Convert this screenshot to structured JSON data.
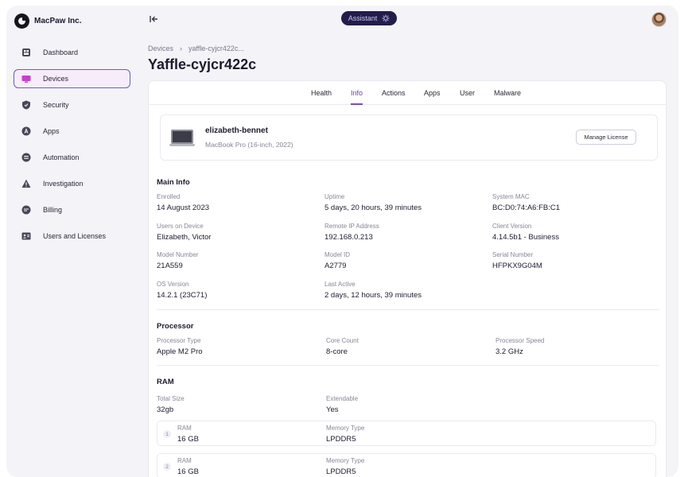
{
  "brand": {
    "name": "MacPaw Inc.",
    "icon": "macpaw-logo-icon"
  },
  "header": {
    "assistant_label": "Assistant",
    "assistant_icon": "sparkle-gear-icon",
    "collapse_icon": "collapse-sidebar-icon",
    "avatar_icon": "user-avatar"
  },
  "sidebar": {
    "items": [
      {
        "label": "Dashboard",
        "icon": "dashboard-icon"
      },
      {
        "label": "Devices",
        "icon": "monitor-icon",
        "active": true
      },
      {
        "label": "Security",
        "icon": "shield-icon"
      },
      {
        "label": "Apps",
        "icon": "apps-icon"
      },
      {
        "label": "Automation",
        "icon": "automation-icon"
      },
      {
        "label": "Investigation",
        "icon": "warning-icon"
      },
      {
        "label": "Billing",
        "icon": "billing-icon"
      },
      {
        "label": "Users and Licenses",
        "icon": "id-card-icon"
      }
    ]
  },
  "breadcrumb": {
    "root": "Devices",
    "separator": "›",
    "current": "yaffle-cyjcr422c..."
  },
  "page": {
    "title": "Yaffle-cyjcr422c"
  },
  "tabs": [
    "Health",
    "Info",
    "Actions",
    "Apps",
    "User",
    "Malware"
  ],
  "active_tab": "Info",
  "device": {
    "name": "elizabeth-bennet",
    "model": "MacBook Pro (16-inch, 2022)",
    "manage_label": "Manage License"
  },
  "main_info": {
    "title": "Main Info",
    "fields": [
      {
        "label": "Enrolled",
        "value": "14 August 2023"
      },
      {
        "label": "Uptime",
        "value": "5 days, 20 hours, 39 minutes"
      },
      {
        "label": "System MAC",
        "value": "BC:D0:74:A6:FB:C1"
      },
      {
        "label": "Users on Device",
        "value": "Elizabeth, Victor"
      },
      {
        "label": "Remote IP Address",
        "value": "192.168.0.213"
      },
      {
        "label": "Client Version",
        "value": "4.14.5b1 - Business"
      },
      {
        "label": "Model Number",
        "value": "21A559"
      },
      {
        "label": "Model ID",
        "value": "A2779"
      },
      {
        "label": "Serial Number",
        "value": "HFPKX9G04M"
      },
      {
        "label": "OS Version",
        "value": "14.2.1 (23C71)"
      },
      {
        "label": "Last Active",
        "value": "2 days, 12 hours, 39 minutes"
      }
    ]
  },
  "processor": {
    "title": "Processor",
    "fields": [
      {
        "label": "Processor Type",
        "value": "Apple M2 Pro"
      },
      {
        "label": "Core Count",
        "value": "8-core"
      },
      {
        "label": "Processor Speed",
        "value": "3.2 GHz"
      }
    ]
  },
  "ram": {
    "title": "RAM",
    "fields": [
      {
        "label": "Total Size",
        "value": "32gb"
      },
      {
        "label": "Extendable",
        "value": "Yes"
      }
    ],
    "modules": [
      {
        "index": "1",
        "ram_label": "RAM",
        "ram_value": "16 GB",
        "type_label": "Memory Type",
        "type_value": "LPDDR5"
      },
      {
        "index": "2",
        "ram_label": "RAM",
        "ram_value": "16 GB",
        "type_label": "Memory Type",
        "type_value": "LPDDR5"
      }
    ]
  }
}
